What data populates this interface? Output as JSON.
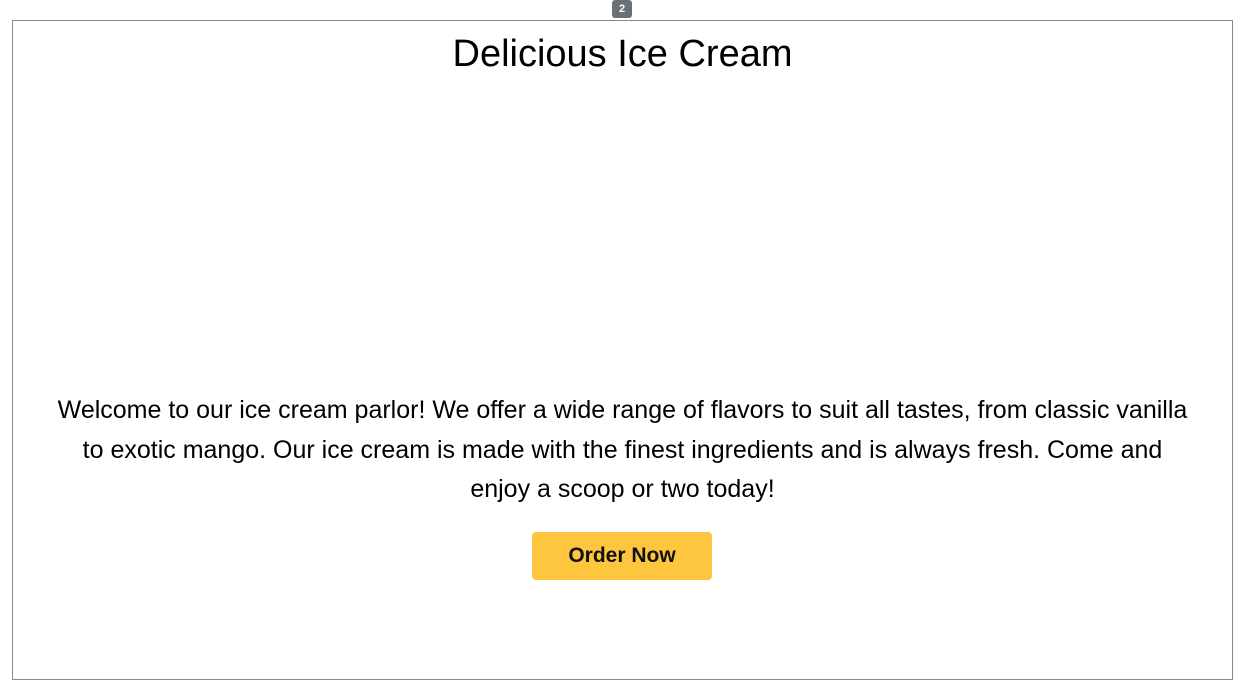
{
  "badge": {
    "count": "2"
  },
  "hero": {
    "title": "Delicious Ice Cream",
    "description": "Welcome to our ice cream parlor! We offer a wide range of flavors to suit all tastes, from classic vanilla to exotic mango. Our ice cream is made with the finest ingredients and is always fresh. Come and enjoy a scoop or two today!",
    "cta_label": "Order Now"
  },
  "colors": {
    "cta_background": "#fec63e",
    "badge_background": "#6b7078",
    "frame_border": "#8a8a8a"
  }
}
